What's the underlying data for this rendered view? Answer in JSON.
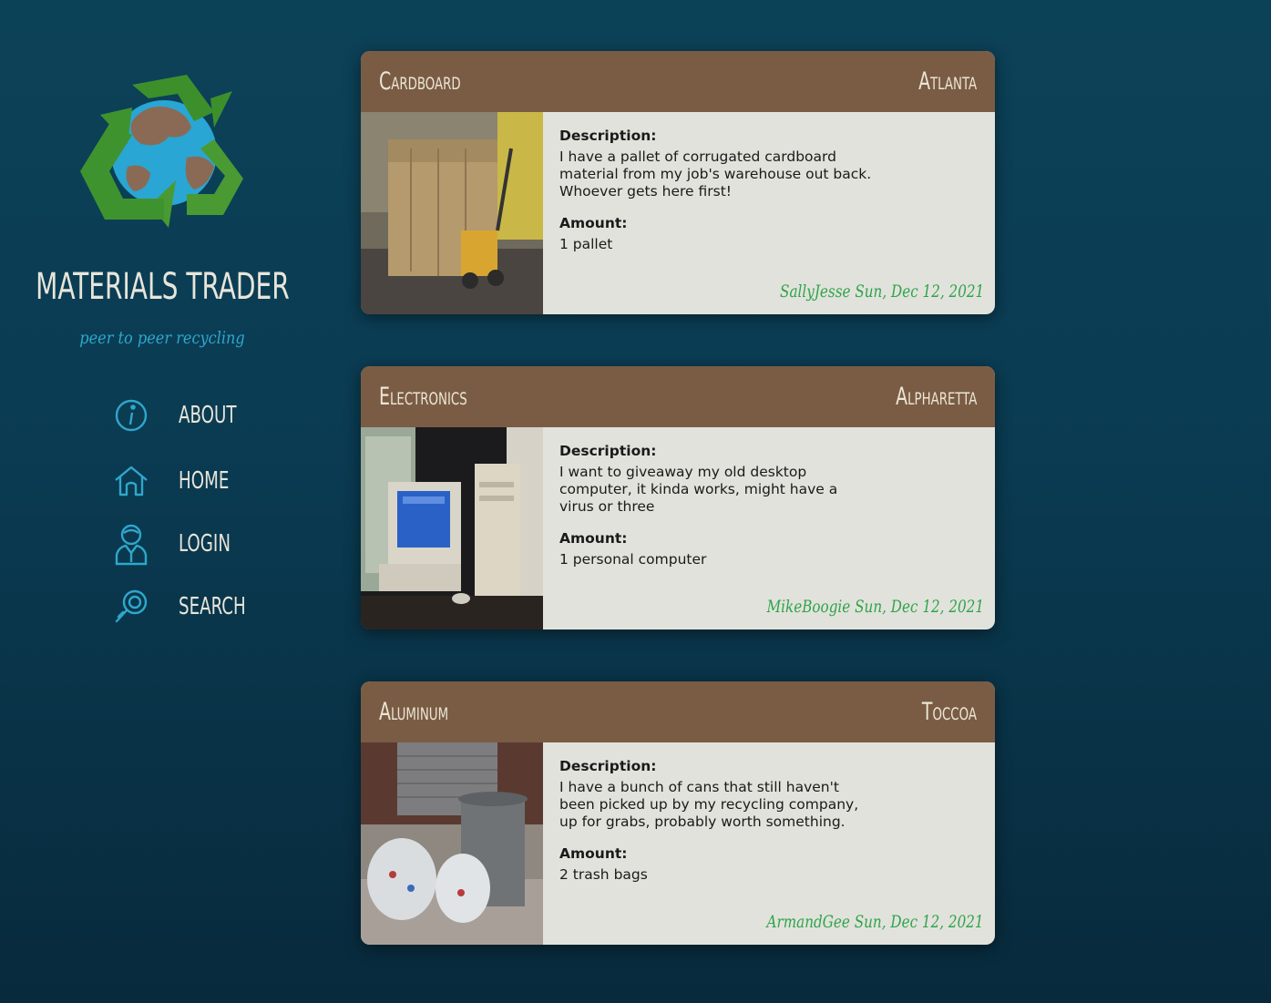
{
  "brand": {
    "title": "MATERIALS TRADER",
    "tagline": "peer to peer recycling",
    "logo_icon": "recycle-globe-icon"
  },
  "nav": {
    "items": [
      {
        "label": "ABOUT",
        "icon": "info-icon"
      },
      {
        "label": "HOME",
        "icon": "home-icon"
      },
      {
        "label": "LOGIN",
        "icon": "user-icon"
      },
      {
        "label": "SEARCH",
        "icon": "search-icon"
      }
    ]
  },
  "listings": [
    {
      "material": "Cardboard",
      "city": "Atlanta",
      "description_label": "Description:",
      "description": "I have a pallet of corrugated cardboard material from my job's warehouse out back. Whoever gets here first!",
      "amount_label": "Amount:",
      "amount": "1 pallet",
      "poster": "SallyJesse",
      "date": "Sun, Dec 12, 2021"
    },
    {
      "material": "Electronics",
      "city": "Alpharetta",
      "description_label": "Description:",
      "description": "I want to giveaway my old desktop computer, it kinda works, might have a virus or three",
      "amount_label": "Amount:",
      "amount": "1 personal computer",
      "poster": "MikeBoogie",
      "date": "Sun, Dec 12, 2021"
    },
    {
      "material": "Aluminum",
      "city": "Toccoa",
      "description_label": "Description:",
      "description": "I have a bunch of cans that still haven't been picked up by my recycling company, up for grabs, probably worth something.",
      "amount_label": "Amount:",
      "amount": "2 trash bags",
      "poster": "ArmandGee",
      "date": "Sun, Dec 12, 2021"
    }
  ],
  "colors": {
    "header": "#7a5c44",
    "card_body": "#e2e2dc",
    "poster_text": "#2ea44a",
    "icon": "#2fa7cc"
  }
}
